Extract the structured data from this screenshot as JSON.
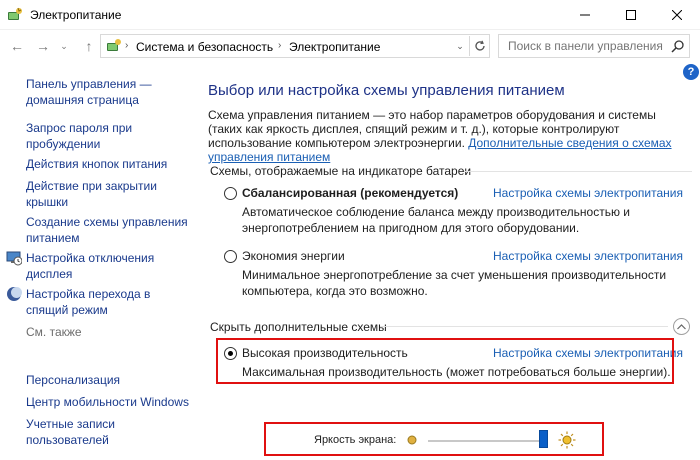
{
  "window": {
    "title": "Электропитание",
    "app_icon": "power-options-icon"
  },
  "address_bar": {
    "crumbs": [
      "Система и безопасность",
      "Электропитание"
    ],
    "search_placeholder": "Поиск в панели управления"
  },
  "sidebar": {
    "links": [
      {
        "label": "Панель управления — домашняя страница",
        "icon": null
      },
      {
        "label": "Запрос пароля при пробуждении",
        "icon": null
      },
      {
        "label": "Действия кнопок питания",
        "icon": null
      },
      {
        "label": "Действие при закрытии крышки",
        "icon": null
      },
      {
        "label": "Создание схемы управления питанием",
        "icon": null
      },
      {
        "label": "Настройка отключения дисплея",
        "icon": "monitor-clock-icon"
      },
      {
        "label": "Настройка перехода в спящий режим",
        "icon": "moon-icon"
      }
    ],
    "see_also_label": "См. также",
    "see_also": [
      {
        "label": "Персонализация"
      },
      {
        "label": "Центр мобильности Windows"
      },
      {
        "label": "Учетные записи пользователей"
      }
    ]
  },
  "main": {
    "title": "Выбор или настройка схемы управления питанием",
    "intro_text": "Схема управления питанием — это набор параметров оборудования и системы (таких как яркость дисплея, спящий режим и т. д.), которые контролируют использование компьютером электроэнергии.",
    "intro_link": "Дополнительные сведения о схемах управления питанием",
    "battery_section_title": "Схемы, отображаемые на индикаторе батареи",
    "hidden_section_title": "Скрыть дополнительные схемы",
    "plans": [
      {
        "name": "Сбалансированная (рекомендуется)",
        "bold": true,
        "selected": false,
        "link": "Настройка схемы электропитания",
        "description": "Автоматическое соблюдение баланса между производительностью и энергопотреблением на пригодном для этого оборудовании."
      },
      {
        "name": "Экономия энергии",
        "bold": false,
        "selected": false,
        "link": "Настройка схемы электропитания",
        "description": "Минимальное энергопотребление за счет уменьшения производительности компьютера, когда это возможно."
      },
      {
        "name": "Высокая производительность",
        "bold": false,
        "selected": true,
        "link": "Настройка схемы электропитания",
        "description": "Максимальная производительность (может потребоваться больше энергии)."
      }
    ]
  },
  "brightness": {
    "label": "Яркость экрана:",
    "value_fraction": 0.92
  },
  "colors": {
    "link": "#1a5fb4",
    "sidebar_link": "#1a3a8c",
    "title": "#1e3287",
    "highlight_box": "#e01010",
    "slider_thumb": "#0a5fc8"
  }
}
